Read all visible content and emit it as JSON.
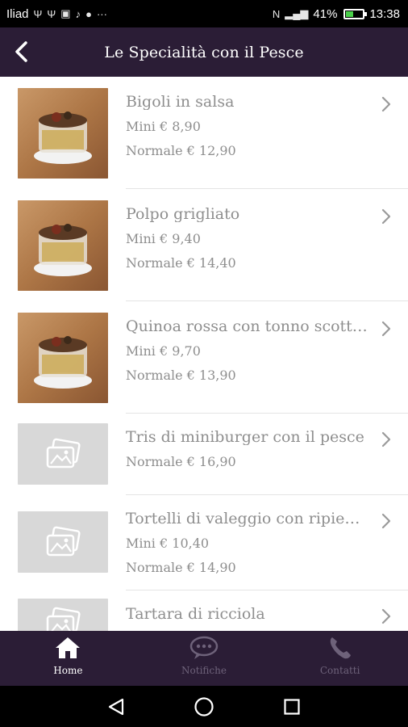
{
  "status_bar": {
    "carrier": "Iliad",
    "battery": "41%",
    "battery_level": 0.41,
    "time": "13:38"
  },
  "header": {
    "title": "Le Specialità con il Pesce"
  },
  "items": [
    {
      "name": "Bigoli in salsa",
      "prices": [
        "Mini € 8,90",
        "Normale € 12,90"
      ],
      "image": "photo"
    },
    {
      "name": "Polpo grigliato",
      "prices": [
        "Mini € 9,40",
        "Normale € 14,40"
      ],
      "image": "photo"
    },
    {
      "name": "Quinoa rossa con tonno scott…",
      "prices": [
        "Mini € 9,70",
        "Normale € 13,90"
      ],
      "image": "photo"
    },
    {
      "name": "Tris di miniburger con il pesce",
      "prices": [
        "Normale € 16,90"
      ],
      "image": "placeholder"
    },
    {
      "name": "Tortelli di valeggio con ripien…",
      "prices": [
        "Mini € 10,40",
        "Normale € 14,90"
      ],
      "image": "placeholder"
    },
    {
      "name": "Tartara di ricciola",
      "prices": [],
      "image": "placeholder"
    }
  ],
  "bottom_nav": [
    {
      "label": "Home",
      "icon": "home-icon",
      "active": true
    },
    {
      "label": "Notifiche",
      "icon": "chat-bubble-icon",
      "active": false
    },
    {
      "label": "Contatti",
      "icon": "phone-icon",
      "active": false
    }
  ],
  "colors": {
    "bar_background": "#2b1d36",
    "text_gray": "#8e8e8e",
    "inactive_nav": "#6e627a"
  }
}
